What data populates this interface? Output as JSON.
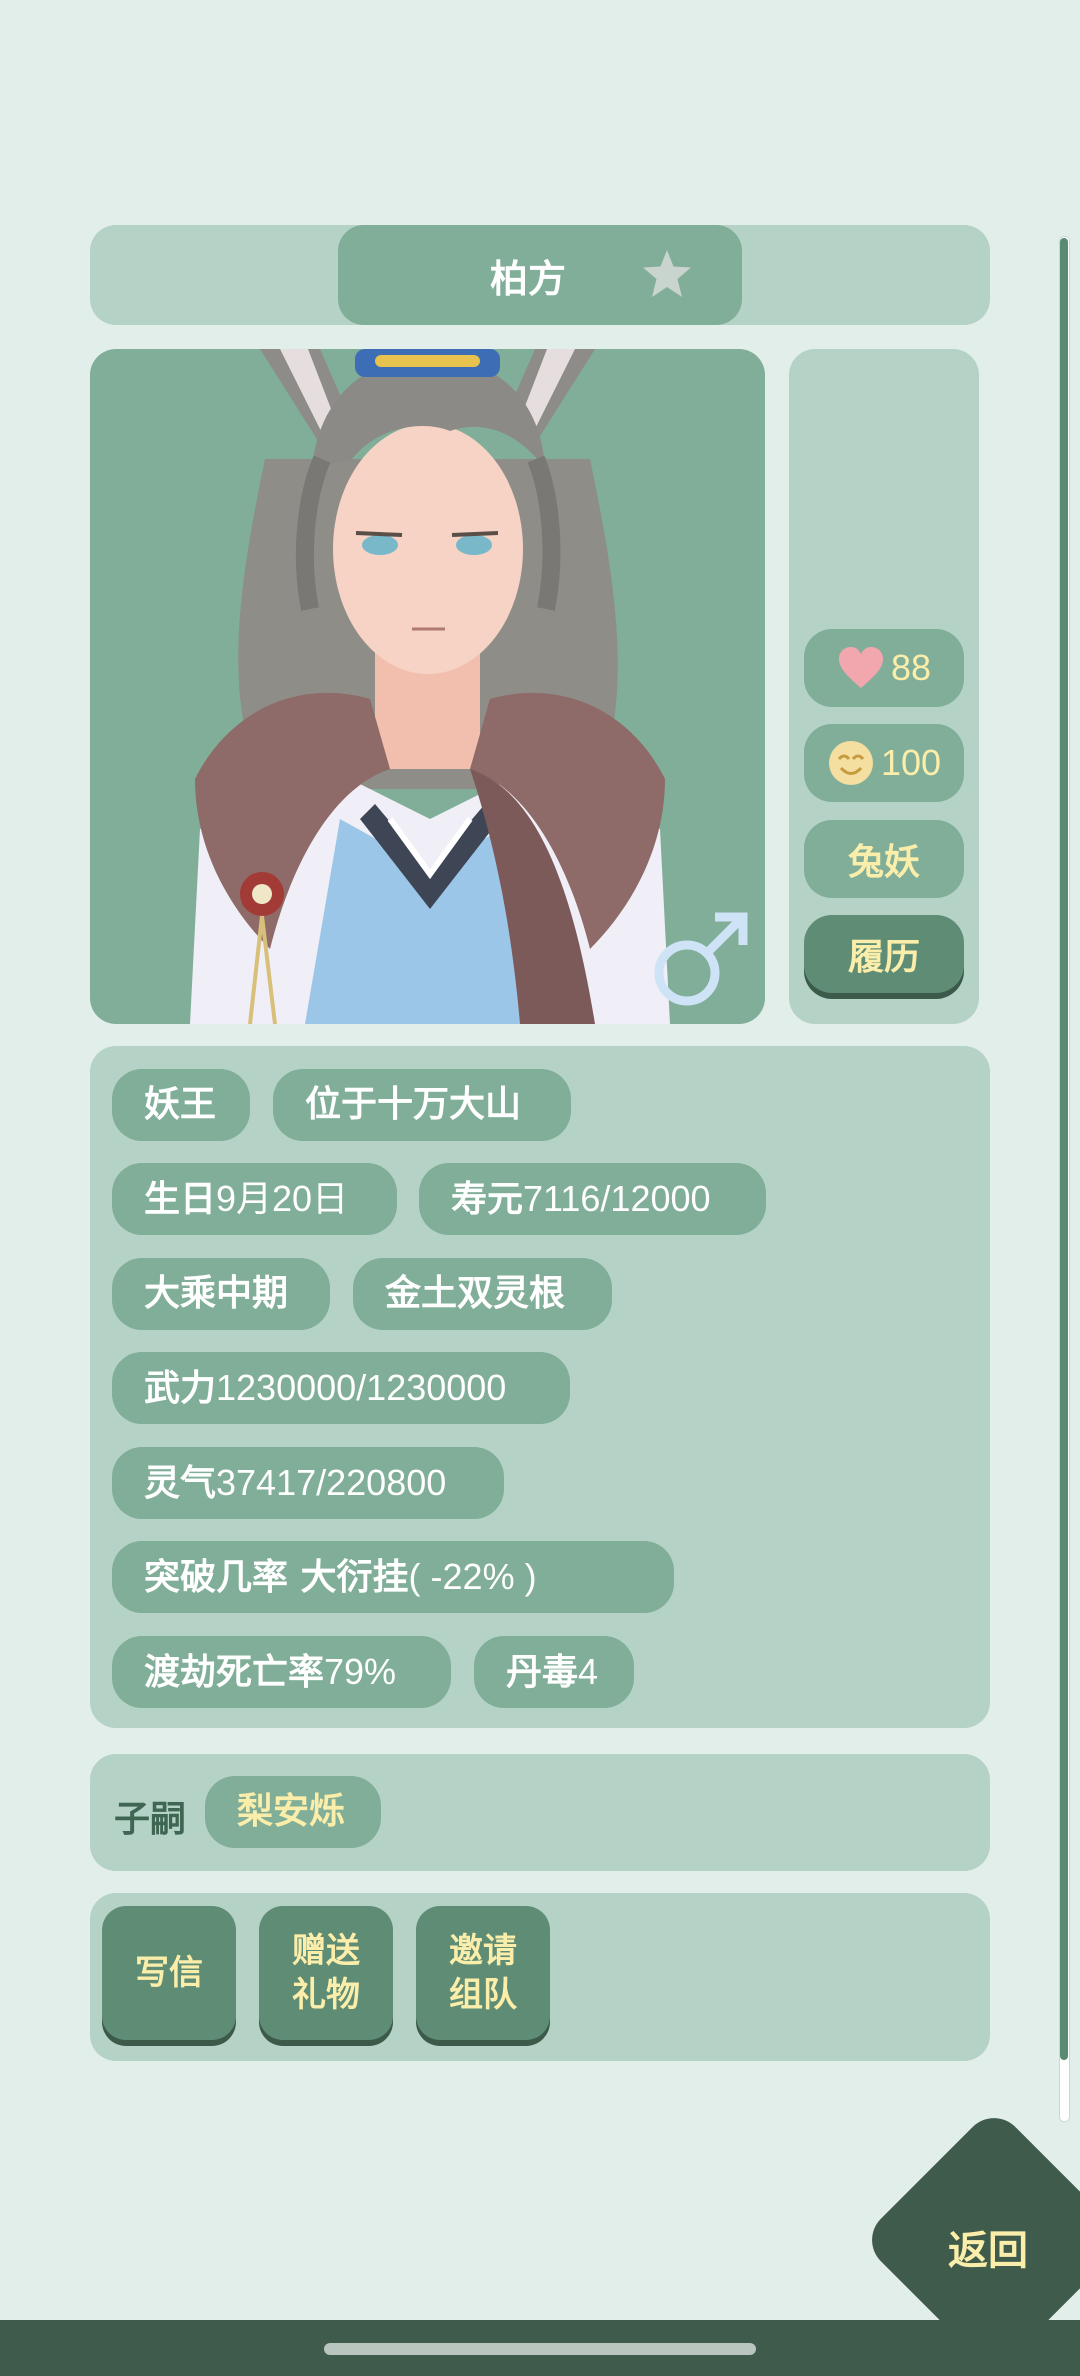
{
  "header": {
    "name": "柏方",
    "favorite_icon": "star-icon"
  },
  "side_stats": {
    "affection": {
      "icon": "heart-icon",
      "value": "88"
    },
    "mood": {
      "icon": "smiley-icon",
      "value": "100"
    },
    "race": "兔妖",
    "resume_label": "履历"
  },
  "portrait": {
    "gender_icon": "male-symbol-icon"
  },
  "info_tags": {
    "title": "妖王",
    "location": "位于十万大山",
    "birthday_label": "生日",
    "birthday_value": "9月20日",
    "lifespan_label": "寿元",
    "lifespan_value": "7116/12000",
    "realm": "大乘中期",
    "root": "金土双灵根",
    "force_label": "武力",
    "force_value": "1230000/1230000",
    "qi_label": "灵气",
    "qi_value": "37417/220800",
    "breakthrough_label": "突破几率 大衍挂",
    "breakthrough_value": "( -22% )",
    "tribulation_label": "渡劫死亡率",
    "tribulation_value": "79%",
    "poison_label": "丹毒",
    "poison_value": "4"
  },
  "heir": {
    "label": "子嗣",
    "name": "梨安烁"
  },
  "actions": {
    "write_letter": "写信",
    "send_gift": "赠送\n礼物",
    "invite_team": "邀请\n组队"
  },
  "back_label": "返回",
  "colors": {
    "background": "#e1eeea",
    "panel": "#b5d2c6",
    "chip": "#80ae98",
    "dark_green": "#5e8c74",
    "accent_yellow": "#fbeeaa",
    "heart": "#f2a7ae"
  }
}
